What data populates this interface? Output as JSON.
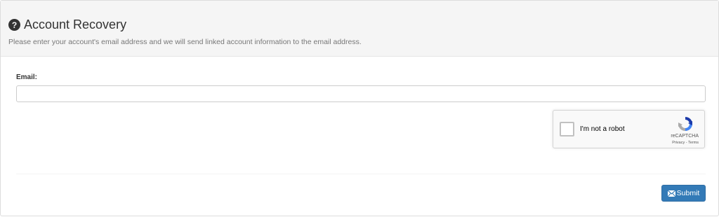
{
  "header": {
    "icon": "question-circle-icon",
    "title": "Account Recovery",
    "subtitle": "Please enter your account's email address and we will send linked account information to the email address."
  },
  "form": {
    "email_label": "Email:",
    "email_value": "",
    "email_placeholder": ""
  },
  "recaptcha": {
    "checkbox_label": "I'm not a robot",
    "brand": "reCAPTCHA",
    "links": "Privacy - Terms",
    "logo_icon": "recaptcha-logo-icon"
  },
  "actions": {
    "submit_label": "Submit",
    "submit_icon": "envelope-icon",
    "submit_color": "#337ab7"
  }
}
